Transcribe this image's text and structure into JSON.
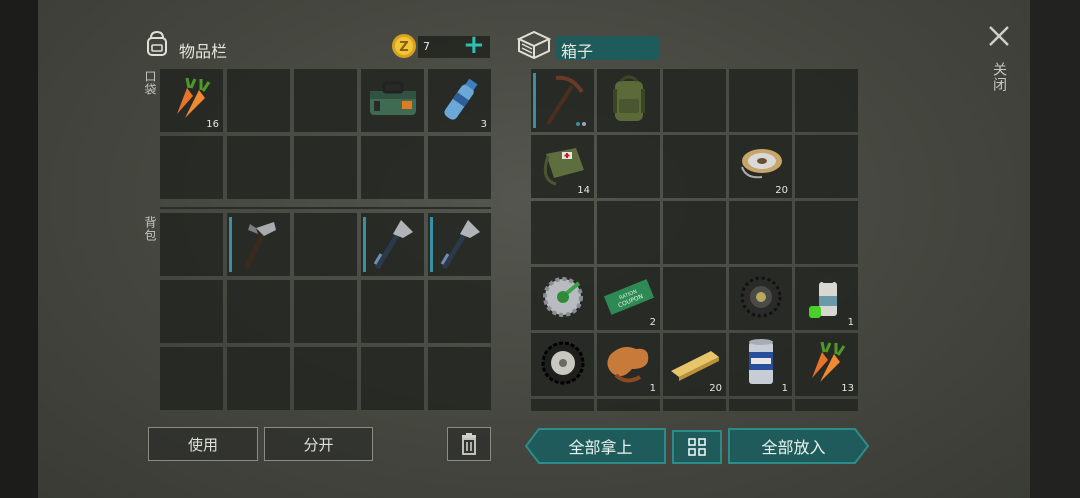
{
  "inventory": {
    "title": "物品栏",
    "coins": "7",
    "add_label": "+",
    "pocket_label": "口袋",
    "backpack_label": "背包",
    "pocket_slots": [
      {
        "item": "carrot",
        "count": "16"
      },
      {
        "item": "",
        "count": ""
      },
      {
        "item": "",
        "count": ""
      },
      {
        "item": "medkit",
        "count": ""
      },
      {
        "item": "water-bottle",
        "count": "3"
      },
      {
        "item": "",
        "count": ""
      },
      {
        "item": "",
        "count": ""
      },
      {
        "item": "",
        "count": ""
      },
      {
        "item": "",
        "count": ""
      },
      {
        "item": "",
        "count": ""
      }
    ],
    "backpack_slots": [
      {
        "item": "",
        "count": ""
      },
      {
        "item": "hammer",
        "count": ""
      },
      {
        "item": "",
        "count": ""
      },
      {
        "item": "hatchet",
        "count": ""
      },
      {
        "item": "hatchet",
        "count": ""
      }
    ],
    "use_label": "使用",
    "split_label": "分开"
  },
  "box": {
    "title": "箱子",
    "take_all_label": "全部拿上",
    "put_all_label": "全部放入",
    "slots": [
      {
        "item": "pickaxe",
        "count": ""
      },
      {
        "item": "backpack",
        "count": ""
      },
      {
        "item": "",
        "count": ""
      },
      {
        "item": "",
        "count": ""
      },
      {
        "item": "",
        "count": ""
      },
      {
        "item": "satchel",
        "count": "14"
      },
      {
        "item": "",
        "count": ""
      },
      {
        "item": "",
        "count": ""
      },
      {
        "item": "wire-spool",
        "count": "20"
      },
      {
        "item": "",
        "count": ""
      },
      {
        "item": "",
        "count": ""
      },
      {
        "item": "",
        "count": ""
      },
      {
        "item": "",
        "count": ""
      },
      {
        "item": "",
        "count": ""
      },
      {
        "item": "",
        "count": ""
      },
      {
        "item": "saw-blade",
        "count": ""
      },
      {
        "item": "coupon",
        "count": "2"
      },
      {
        "item": "",
        "count": ""
      },
      {
        "item": "tire",
        "count": ""
      },
      {
        "item": "spray-can",
        "count": "1"
      },
      {
        "item": "wheel",
        "count": ""
      },
      {
        "item": "leather",
        "count": "1"
      },
      {
        "item": "plank",
        "count": "20"
      },
      {
        "item": "beer-can",
        "count": "1"
      },
      {
        "item": "carrot",
        "count": "13"
      }
    ],
    "coupon_text_1": "RATION",
    "coupon_text_2": "COUPON"
  },
  "close": {
    "label": "关闭",
    "icon": "close-icon"
  },
  "colors": {
    "teal": "#1e5b5a",
    "teal_border": "#2c8c89",
    "durability": "#3a8fa0",
    "plus": "#2fc0b0"
  }
}
